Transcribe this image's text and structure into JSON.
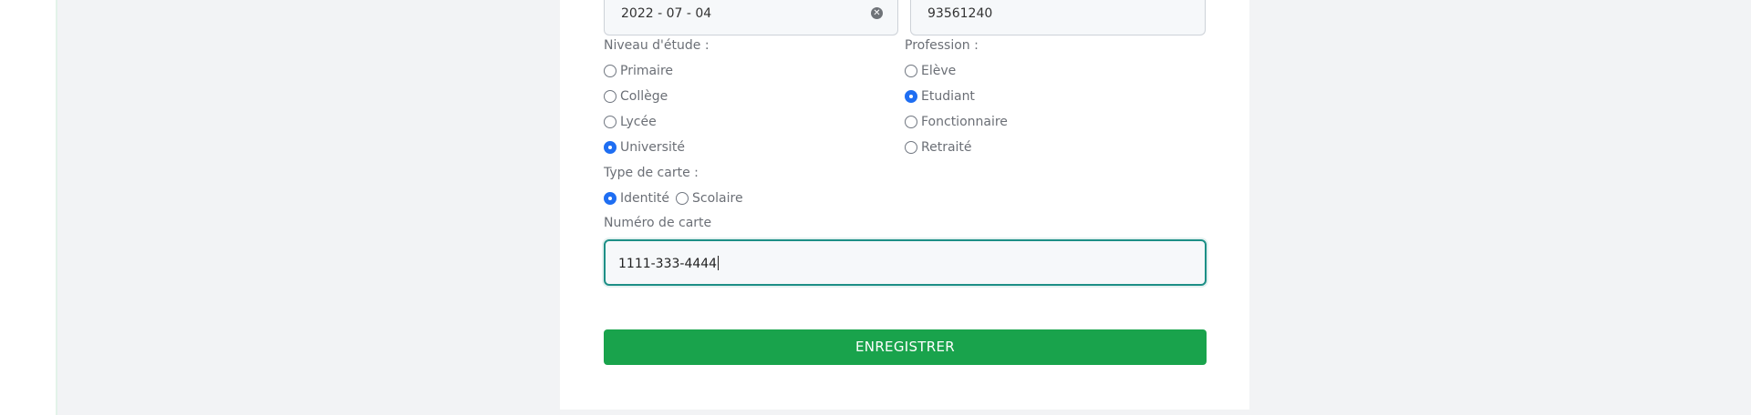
{
  "date_field": {
    "value": "2022 - 07 - 04",
    "clear_icon": "clear-icon"
  },
  "phone_field": {
    "value": "93561240"
  },
  "niveau": {
    "label": "Niveau d'étude :",
    "options": [
      {
        "label": "Primaire",
        "checked": false
      },
      {
        "label": "Collège",
        "checked": false
      },
      {
        "label": "Lycée",
        "checked": false
      },
      {
        "label": "Université",
        "checked": true
      }
    ]
  },
  "profession": {
    "label": "Profession :",
    "options": [
      {
        "label": "Elève",
        "checked": false
      },
      {
        "label": "Etudiant",
        "checked": true
      },
      {
        "label": "Fonctionnaire",
        "checked": false
      },
      {
        "label": "Retraité",
        "checked": false
      }
    ]
  },
  "type_carte": {
    "label": "Type de carte :",
    "options": [
      {
        "label": "Identité",
        "checked": true
      },
      {
        "label": "Scolaire",
        "checked": false
      }
    ]
  },
  "numero_carte": {
    "label": "Numéro de carte",
    "value": "1111-333-4444"
  },
  "submit": {
    "label": "ENREGISTRER"
  },
  "colors": {
    "accent": "#1f6ef2",
    "submit": "#19a34c",
    "focus": "#1d8f86"
  }
}
